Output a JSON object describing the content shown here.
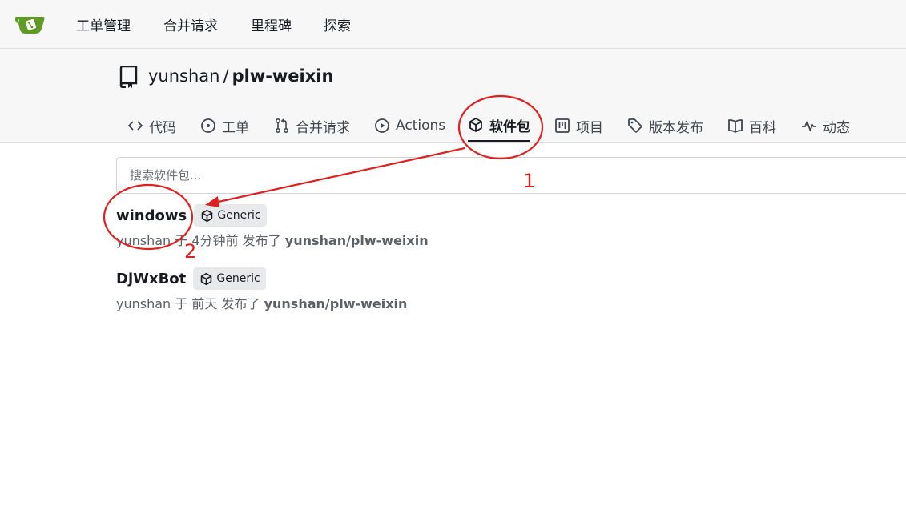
{
  "nav": {
    "items": [
      "工单管理",
      "合并请求",
      "里程碑",
      "探索"
    ]
  },
  "repo": {
    "owner": "yunshan",
    "separator": "/",
    "name": "plw-weixin"
  },
  "tabs": [
    {
      "label": "代码",
      "icon": "code-icon"
    },
    {
      "label": "工单",
      "icon": "issue-icon"
    },
    {
      "label": "合并请求",
      "icon": "pull-request-icon"
    },
    {
      "label": "Actions",
      "icon": "play-icon"
    },
    {
      "label": "软件包",
      "icon": "package-icon",
      "active": true
    },
    {
      "label": "项目",
      "icon": "project-icon"
    },
    {
      "label": "版本发布",
      "icon": "tag-icon"
    },
    {
      "label": "百科",
      "icon": "book-icon"
    },
    {
      "label": "动态",
      "icon": "pulse-icon"
    }
  ],
  "search": {
    "placeholder": "搜索软件包..."
  },
  "packages": [
    {
      "name": "windows",
      "type": "Generic",
      "user": "yunshan",
      "prep": "于",
      "time": "4分钟前",
      "action": "发布了",
      "repo": "yunshan/plw-weixin"
    },
    {
      "name": "DjWxBot",
      "type": "Generic",
      "user": "yunshan",
      "prep": "于",
      "time": "前天",
      "action": "发布了",
      "repo": "yunshan/plw-weixin"
    }
  ],
  "annotations": {
    "label_1": "1",
    "label_2": "2",
    "color": "#e02020"
  },
  "colors": {
    "header_bg": "#f7f7f8",
    "logo_green": "#609926",
    "text": "#181c21",
    "muted": "#5c6067"
  }
}
